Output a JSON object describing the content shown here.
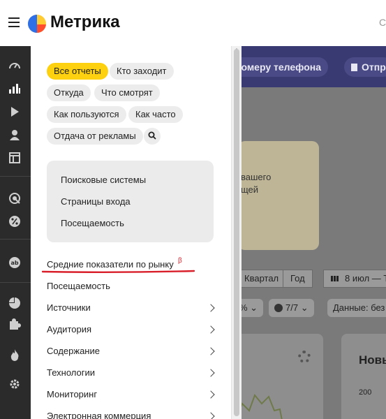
{
  "header": {
    "brand": "Метрика",
    "right_text": "С"
  },
  "sidebar": {
    "icons": [
      "dashboard-icon",
      "reports-icon",
      "play-icon",
      "user-icon",
      "layout-icon",
      "target-icon",
      "percent-icon",
      "ab-icon",
      "pie-icon",
      "puzzle-icon",
      "fire-icon",
      "settings-icon"
    ]
  },
  "menu": {
    "pills": [
      {
        "label": "Все отчеты",
        "active": true
      },
      {
        "label": "Кто заходит"
      },
      {
        "label": "Откуда"
      },
      {
        "label": "Что смотрят"
      },
      {
        "label": "Как пользуются"
      },
      {
        "label": "Как часто"
      },
      {
        "label": "Отдача от рекламы"
      }
    ],
    "search_icon": "search-icon",
    "submenu": [
      "Поисковые системы",
      "Страницы входа",
      "Посещаемость"
    ],
    "items": [
      {
        "label": "Средние показатели по рынку",
        "badge": "β"
      },
      {
        "label": "Посещаемость"
      },
      {
        "label": "Источники"
      },
      {
        "label": "Аудитория"
      },
      {
        "label": "Содержание"
      },
      {
        "label": "Технологии"
      },
      {
        "label": "Мониторинг"
      },
      {
        "label": "Электронная коммерция"
      }
    ]
  },
  "background": {
    "phone_button": "номеру телефона",
    "send_button": "Отпр",
    "card_line1": "вашего",
    "card_line2": "щей",
    "period_quarter": "Квартал",
    "period_year": "Год",
    "date_range": "8 июл — Т",
    "percent_chip": "%",
    "visits_chip": "7/7",
    "data_chip": "Данные: без",
    "widget_title": "Новы",
    "axis_value": "200"
  },
  "colors": {
    "accent": "#fdd10f",
    "underline": "#d81f2a",
    "sidebar": "#2b2b2b"
  }
}
